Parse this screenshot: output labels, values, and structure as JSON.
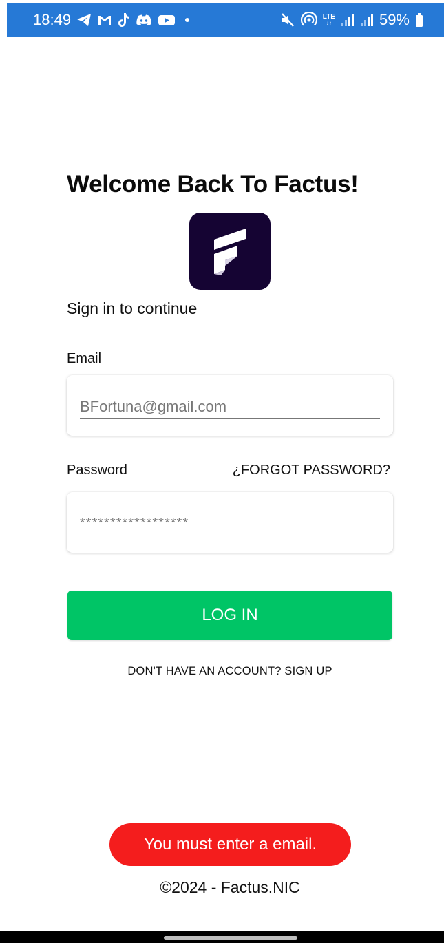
{
  "status_bar": {
    "time": "18:49",
    "left_icons": [
      "telegram-icon",
      "gmail-icon",
      "tiktok-icon",
      "discord-icon",
      "youtube-icon"
    ],
    "right_icons": [
      "mute-icon",
      "hotspot-icon",
      "lte-icon",
      "signal-icon",
      "signal-icon",
      "battery-icon"
    ],
    "lte_label": "LTE",
    "battery": "59%",
    "background": "#2679d6"
  },
  "login": {
    "title": "Welcome Back To Factus!",
    "subtitle": "Sign in to continue",
    "logo_icon": "factus-logo-icon",
    "logo_color": "#150433",
    "email": {
      "label": "Email",
      "value": "BFortuna@gmail.com"
    },
    "password": {
      "label": "Password",
      "value": "******************",
      "forgot_label": "¿FORGOT PASSWORD?"
    },
    "login_button": "LOG IN",
    "login_button_color": "#00c566",
    "signup_link": "DON'T HAVE AN ACCOUNT? SIGN UP"
  },
  "toast": {
    "message": "You must enter a email.",
    "color": "#f41d1d"
  },
  "footer": {
    "copyright": "©2024 - Factus.NIC"
  }
}
